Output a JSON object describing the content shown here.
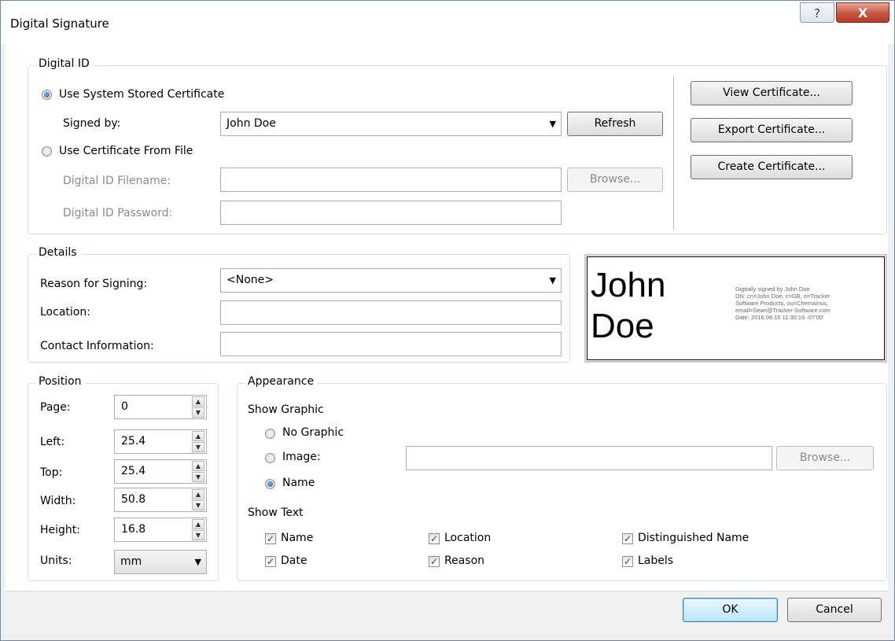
{
  "window": {
    "title": "Digital Signature",
    "help_glyph": "?",
    "close_glyph": "X"
  },
  "digital_id": {
    "legend": "Digital ID",
    "use_system_label": "Use System Stored Certificate",
    "use_system_selected": true,
    "signed_by_label": "Signed by:",
    "signed_by_value": "John Doe",
    "refresh_label": "Refresh",
    "use_file_label": "Use Certificate From File",
    "use_file_selected": false,
    "filename_label": "Digital ID Filename:",
    "filename_value": "",
    "password_label": "Digital ID Password:",
    "password_value": "",
    "browse_label": "Browse...",
    "view_cert_label": "View Certificate...",
    "export_cert_label": "Export Certificate...",
    "create_cert_label": "Create Certificate..."
  },
  "details": {
    "legend": "Details",
    "reason_label": "Reason for Signing:",
    "reason_value": "<None>",
    "location_label": "Location:",
    "location_value": "",
    "contact_label": "Contact Information:",
    "contact_value": ""
  },
  "preview": {
    "name_line1": "John",
    "name_line2": "Doe",
    "detail_lines": [
      "Digitally signed by John Doe",
      "DN: cn=John Doe, c=GB, o=Tracker",
      "Software Products, ou=Chemainus,",
      "email=Sean@Tracker-Software.com",
      "Date: 2016.06.15 11:30:16 -07'00'"
    ]
  },
  "position": {
    "legend": "Position",
    "page_label": "Page:",
    "page_value": "0",
    "left_label": "Left:",
    "left_value": "25.4",
    "top_label": "Top:",
    "top_value": "25.4",
    "width_label": "Width:",
    "width_value": "50.8",
    "height_label": "Height:",
    "height_value": "16.8",
    "units_label": "Units:",
    "units_value": "mm"
  },
  "appearance": {
    "legend": "Appearance",
    "show_graphic_label": "Show Graphic",
    "no_graphic_label": "No Graphic",
    "image_label": "Image:",
    "name_label": "Name",
    "graphic_selected": "Name",
    "image_path": "",
    "browse_label": "Browse...",
    "show_text_label": "Show Text",
    "checks": {
      "name": {
        "label": "Name",
        "checked": true
      },
      "date": {
        "label": "Date",
        "checked": true
      },
      "location": {
        "label": "Location",
        "checked": true
      },
      "reason": {
        "label": "Reason",
        "checked": true
      },
      "distinguished": {
        "label": "Distinguished Name",
        "checked": true
      },
      "labels": {
        "label": "Labels",
        "checked": true
      }
    },
    "check_glyph": "✓"
  },
  "footer": {
    "ok_label": "OK",
    "cancel_label": "Cancel"
  }
}
